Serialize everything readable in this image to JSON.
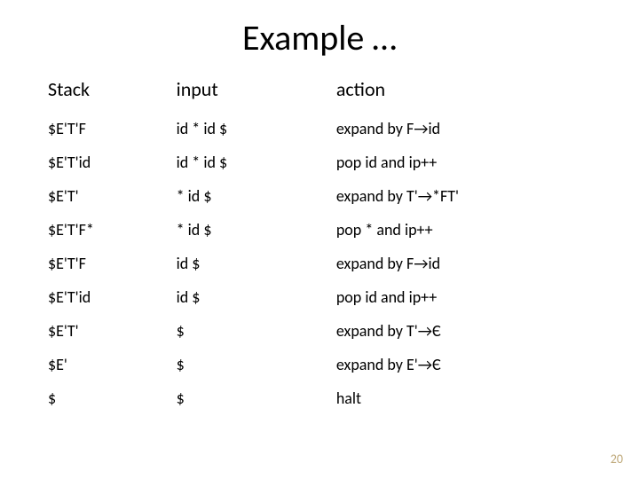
{
  "title": "Example …",
  "headers": {
    "stack": "Stack",
    "input": "input",
    "action": "action"
  },
  "rows": [
    {
      "stack": "$E'T'F",
      "input": "id * id $",
      "action": "expand by F→id"
    },
    {
      "stack": "$E'T'id",
      "input": "id * id $",
      "action": "pop id and ip++"
    },
    {
      "stack": "$E'T'",
      "input": "* id $",
      "action": "expand by T'→*FT'"
    },
    {
      "stack": "$E'T'F*",
      "input": "* id $",
      "action": "pop * and ip++"
    },
    {
      "stack": "$E'T'F",
      "input": "id $",
      "action": "expand by F→id"
    },
    {
      "stack": "$E'T'id",
      "input": "id $",
      "action": "pop id and ip++"
    },
    {
      "stack": "$E'T'",
      "input": "$",
      "action": "expand by T'→Є"
    },
    {
      "stack": "$E'",
      "input": "$",
      "action": "expand by E'→Є"
    },
    {
      "stack": "$",
      "input": "$",
      "action": "halt"
    }
  ],
  "page_number": "20"
}
